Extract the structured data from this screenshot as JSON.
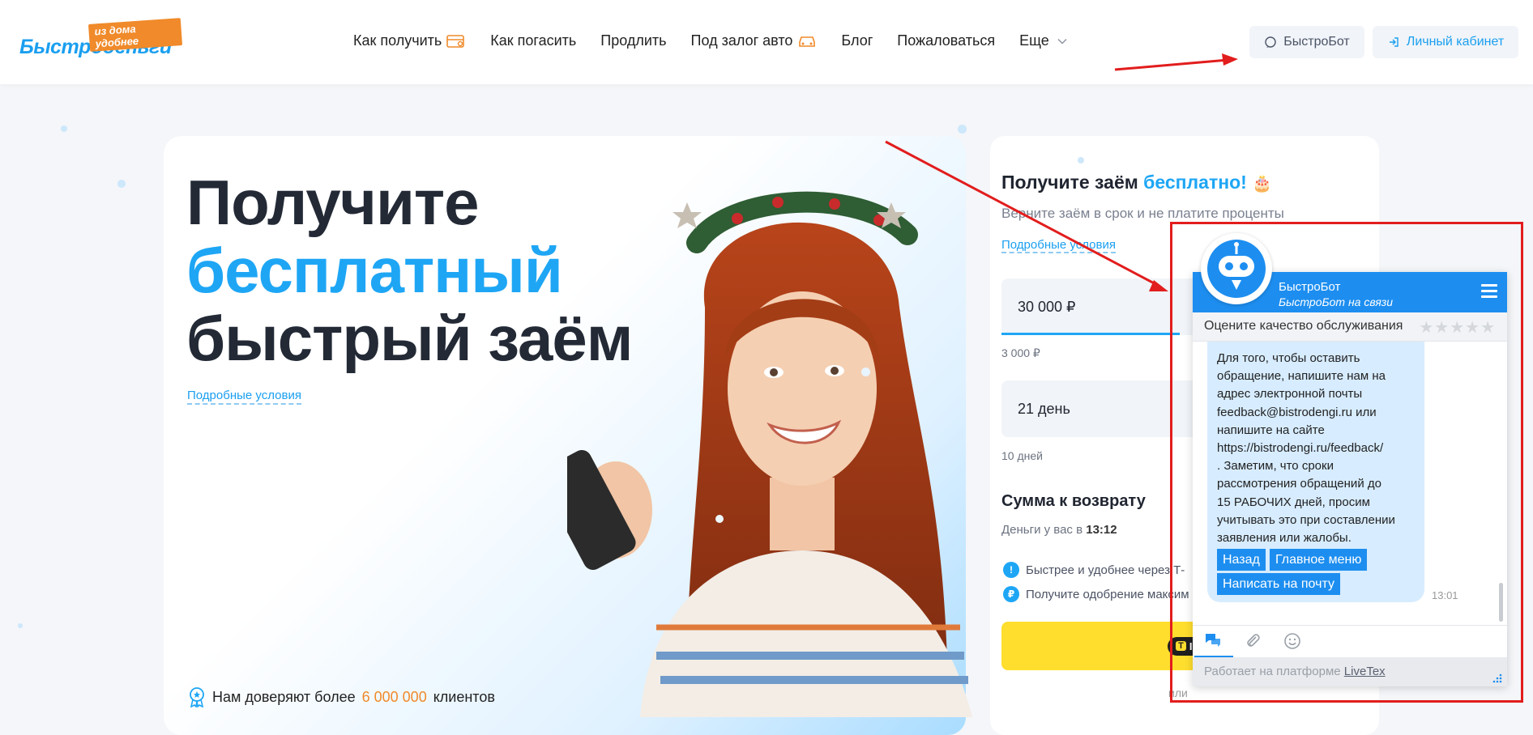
{
  "header": {
    "logo_main": "Быстроденьги",
    "logo_badge": "из дома удобнее",
    "nav": [
      {
        "label": "Как получить",
        "icon": "card-icon"
      },
      {
        "label": "Как погасить"
      },
      {
        "label": "Продлить"
      },
      {
        "label": "Под залог авто",
        "icon": "car-icon"
      },
      {
        "label": "Блог"
      },
      {
        "label": "Пожаловаться"
      },
      {
        "label": "Еще",
        "icon": "chevron-down-icon"
      }
    ],
    "bot_button": "БыстроБот",
    "cabinet_button": "Личный кабинет"
  },
  "hero": {
    "line1": "Получите",
    "line2": "бесплатный",
    "line3": "быстрый заём",
    "details_link": "Подробные условия",
    "trust_prefix": "Нам доверяют более",
    "trust_number": "6 000 000",
    "trust_suffix": "клиентов"
  },
  "calculator": {
    "title_prefix": "Получите заём",
    "title_accent": "бесплатно!",
    "subtitle": "Верните заём в срок и не платите проценты",
    "details_link": "Подробные условия",
    "amount_value": "30 000 ₽",
    "amount_min": "3 000 ₽",
    "term_value": "21 день",
    "term_min": "10 дней",
    "sum_title": "Сумма к возврату",
    "sum_sub_prefix": "Деньги у вас в",
    "sum_sub_time": "13:12",
    "perk1": "Быстрее и удобнее через Т-",
    "perk2": "Получите одобрение максим",
    "tid_label": "ID",
    "tid_logo": "Т",
    "or_text": "или"
  },
  "chat": {
    "name": "БыстроБот",
    "status": "БыстроБот на связи",
    "rate_label": "Оцените качество обслуживания",
    "stars": "★★★★★",
    "message_lines": [
      "Для того, чтобы оставить",
      "обращение, напишите нам на",
      "адрес электронной почты",
      "feedback@bistrodengi.ru или",
      "напишите на сайте",
      "https://bistrodengi.ru/feedback/",
      ". Заметим, что сроки",
      "рассмотрения обращений до",
      "15 РАБОЧИХ дней, просим",
      "учитывать это при составлении",
      "заявления или жалобы."
    ],
    "btn_back": "Назад",
    "btn_main": "Главное меню",
    "btn_mail": "Написать на почту",
    "time": "13:01",
    "footer_prefix": "Работает на платформе",
    "footer_link": "LiveTex"
  },
  "colors": {
    "brand_blue": "#1ea6f5",
    "chat_blue": "#1d8ef0",
    "accent_orange": "#f08a2a",
    "tid_yellow": "#ffde2e",
    "annotation_red": "#e21d1d"
  }
}
